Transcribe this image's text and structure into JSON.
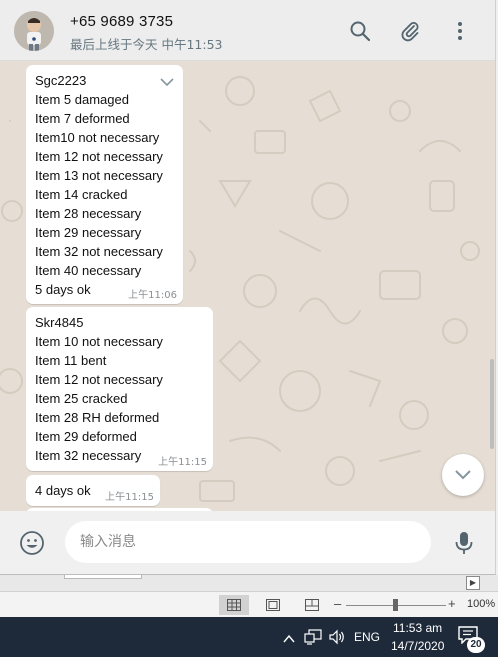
{
  "contact": {
    "name": "+65 9689 3735",
    "status": "最后上线于今天 中午11:53"
  },
  "messages": [
    {
      "lines": [
        "Sgc2223",
        "Item 5 damaged",
        "Item 7 deformed",
        "Item10 not necessary",
        "Item 12 not necessary",
        "Item 13 not necessary",
        "Item 14 cracked",
        "Item 28 necessary",
        "Item 29 necessary",
        "Item 32 not necessary",
        "Item 40 necessary",
        "5 days ok"
      ],
      "time": "上午11:06"
    },
    {
      "lines": [
        "Skr4845",
        "Item 10 not necessary",
        "Item 11 bent",
        "Item 12 not necessary",
        "Item 25 cracked",
        "Item 28 RH deformed",
        "Item 29 deformed",
        "Item 32 necessary"
      ],
      "time": "上午11:15"
    },
    {
      "lines": [
        "4 days ok"
      ],
      "time": "上午11:15"
    }
  ],
  "composer": {
    "placeholder": "输入消息"
  },
  "icons": {
    "search": "search-icon",
    "attach": "paperclip-icon",
    "menu": "kebab-menu-icon",
    "emoji": "emoji-icon",
    "mic": "microphone-icon",
    "scroll_down": "chevron-down-icon"
  },
  "excel_status": {
    "zoom": "100%"
  },
  "taskbar": {
    "language": "ENG",
    "time": "11:53 am",
    "date": "14/7/2020",
    "notification_count": "20"
  },
  "colors": {
    "chat_background": "#e6ded4",
    "header_background": "#ededed",
    "bubble": "#ffffff",
    "taskbar": "#1e2a3a"
  }
}
